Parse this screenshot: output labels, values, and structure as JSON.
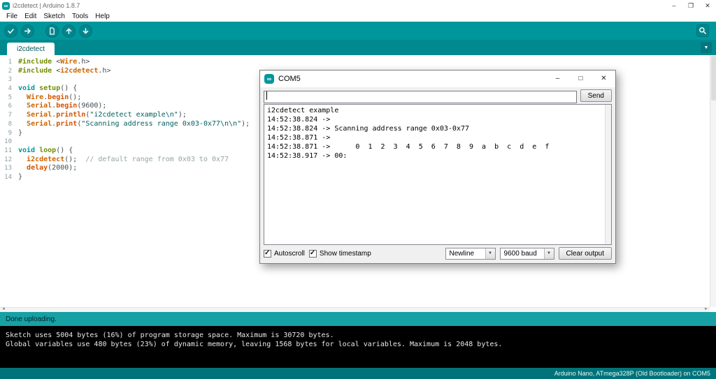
{
  "window": {
    "title": "i2cdetect | Arduino 1.8.7"
  },
  "menu": {
    "items": [
      "File",
      "Edit",
      "Sketch",
      "Tools",
      "Help"
    ]
  },
  "toolbar": {
    "icons": [
      "verify-check",
      "upload-arrow",
      "new-document",
      "open-up-arrow",
      "save-down-arrow",
      "serial-monitor-magnifier"
    ]
  },
  "tabs": {
    "active": "i2cdetect"
  },
  "editor": {
    "lines": [
      [
        {
          "t": "#include ",
          "c": "pp"
        },
        {
          "t": "<",
          "c": "d"
        },
        {
          "t": "Wire",
          "c": "cls"
        },
        {
          "t": ".h>",
          "c": "d"
        }
      ],
      [
        {
          "t": "#include ",
          "c": "pp"
        },
        {
          "t": "<",
          "c": "d"
        },
        {
          "t": "i2cdetect",
          "c": "cls"
        },
        {
          "t": ".h>",
          "c": "d"
        }
      ],
      [],
      [
        {
          "t": "void ",
          "c": "kw"
        },
        {
          "t": "setup",
          "c": "fn2"
        },
        {
          "t": "() {",
          "c": "d"
        }
      ],
      [
        {
          "t": "  ",
          "c": "d"
        },
        {
          "t": "Wire",
          "c": "cls"
        },
        {
          "t": ".",
          "c": "d"
        },
        {
          "t": "begin",
          "c": "fn"
        },
        {
          "t": "();",
          "c": "d"
        }
      ],
      [
        {
          "t": "  ",
          "c": "d"
        },
        {
          "t": "Serial",
          "c": "cls"
        },
        {
          "t": ".",
          "c": "d"
        },
        {
          "t": "begin",
          "c": "fn"
        },
        {
          "t": "(9600);",
          "c": "d"
        }
      ],
      [
        {
          "t": "  ",
          "c": "d"
        },
        {
          "t": "Serial",
          "c": "cls"
        },
        {
          "t": ".",
          "c": "d"
        },
        {
          "t": "println",
          "c": "fn"
        },
        {
          "t": "(",
          "c": "d"
        },
        {
          "t": "\"i2cdetect example\\n\"",
          "c": "str"
        },
        {
          "t": ");",
          "c": "d"
        }
      ],
      [
        {
          "t": "  ",
          "c": "d"
        },
        {
          "t": "Serial",
          "c": "cls"
        },
        {
          "t": ".",
          "c": "d"
        },
        {
          "t": "print",
          "c": "fn"
        },
        {
          "t": "(",
          "c": "d"
        },
        {
          "t": "\"Scanning address range 0x03-0x77\\n\\n\"",
          "c": "str"
        },
        {
          "t": ");",
          "c": "d"
        }
      ],
      [
        {
          "t": "}",
          "c": "d"
        }
      ],
      [],
      [
        {
          "t": "void ",
          "c": "kw"
        },
        {
          "t": "loop",
          "c": "fn2"
        },
        {
          "t": "() {",
          "c": "d"
        }
      ],
      [
        {
          "t": "  ",
          "c": "d"
        },
        {
          "t": "i2cdetect",
          "c": "cls"
        },
        {
          "t": "();  ",
          "c": "d"
        },
        {
          "t": "// default range from 0x03 to 0x77",
          "c": "com"
        }
      ],
      [
        {
          "t": "  ",
          "c": "d"
        },
        {
          "t": "delay",
          "c": "fn"
        },
        {
          "t": "(2000);",
          "c": "d"
        }
      ],
      [
        {
          "t": "}",
          "c": "d"
        }
      ]
    ]
  },
  "status": {
    "message": "Done uploading."
  },
  "console": {
    "lines": [
      "Sketch uses 5004 bytes (16%) of program storage space. Maximum is 30720 bytes.",
      "Global variables use 480 bytes (23%) of dynamic memory, leaving 1568 bytes for local variables. Maximum is 2048 bytes."
    ]
  },
  "footer": {
    "board_info": "Arduino Nano, ATmega328P (Old Bootloader) on COM5"
  },
  "serial_monitor": {
    "title": "COM5",
    "input_value": "",
    "send_label": "Send",
    "output": [
      "i2cdetect example",
      "14:52:38.824 -> ",
      "14:52:38.824 -> Scanning address range 0x03-0x77",
      "14:52:38.871 -> ",
      "14:52:38.871 ->      0  1  2  3  4  5  6  7  8  9  a  b  c  d  e  f",
      "14:52:38.917 -> 00:"
    ],
    "autoscroll_label": "Autoscroll",
    "autoscroll_checked": true,
    "timestamp_label": "Show timestamp",
    "timestamp_checked": true,
    "line_ending": "Newline",
    "baud": "9600 baud",
    "clear_label": "Clear output"
  },
  "colors": {
    "accent": "#00979C",
    "status_bar": "#17A1A5",
    "console_bg": "#000000"
  }
}
